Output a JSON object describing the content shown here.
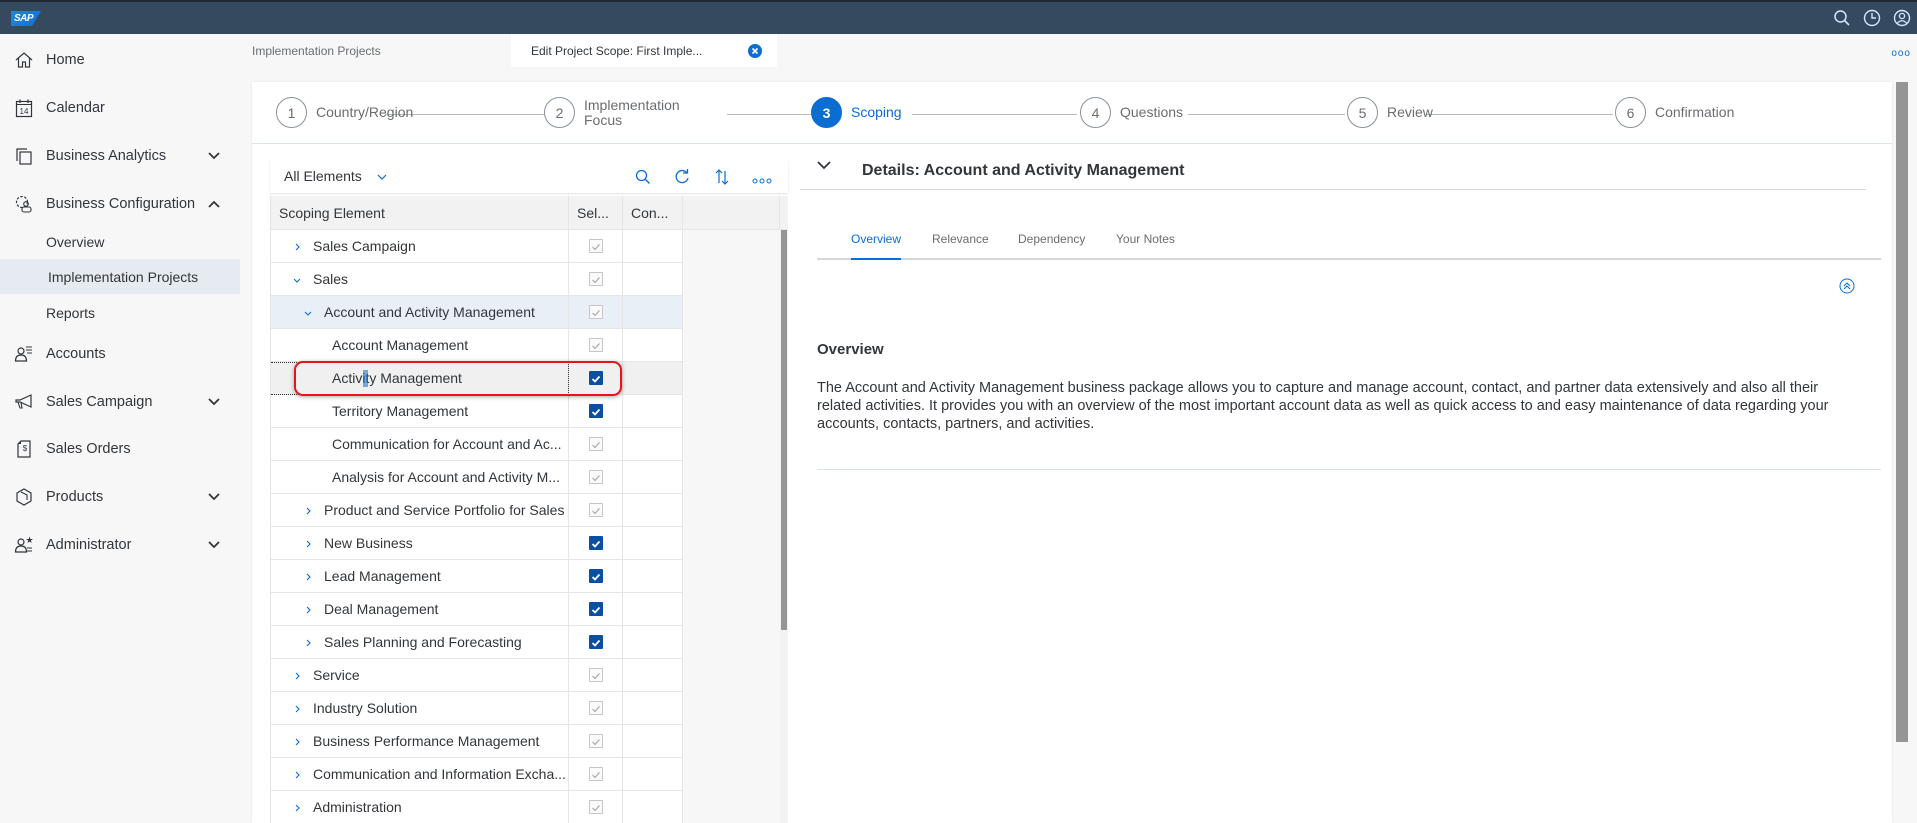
{
  "shell": {
    "logo": "SAP",
    "icons": [
      "search-icon",
      "history-icon",
      "user-icon"
    ]
  },
  "sidebar": {
    "items": [
      {
        "label": "Home",
        "icon": "home-icon"
      },
      {
        "label": "Calendar",
        "icon": "calendar-icon",
        "icon_text": "14"
      },
      {
        "label": "Business Analytics",
        "icon": "analytics-icon",
        "expandable": true,
        "expanded": false
      },
      {
        "label": "Business Configuration",
        "icon": "settings-icon",
        "expandable": true,
        "expanded": true
      },
      {
        "label": "Accounts",
        "icon": "accounts-icon"
      },
      {
        "label": "Sales Campaign",
        "icon": "campaign-icon",
        "expandable": true,
        "expanded": false
      },
      {
        "label": "Sales Orders",
        "icon": "sales-order-icon"
      },
      {
        "label": "Products",
        "icon": "product-icon",
        "expandable": true,
        "expanded": false
      },
      {
        "label": "Administrator",
        "icon": "administrator-icon",
        "expandable": true,
        "expanded": false
      }
    ],
    "sub_items": [
      {
        "label": "Overview",
        "active": false
      },
      {
        "label": "Implementation Projects",
        "active": true
      },
      {
        "label": "Reports",
        "active": false
      }
    ]
  },
  "tabs": [
    {
      "label": "Implementation Projects",
      "active": false
    },
    {
      "label": "Edit Project Scope: First Imple...",
      "active": true,
      "closable": true
    }
  ],
  "wizard": {
    "steps": [
      {
        "number": "1",
        "label": "Country/Region",
        "active": false
      },
      {
        "number": "2",
        "label": "Implementation Focus",
        "active": false
      },
      {
        "number": "3",
        "label": "Scoping",
        "active": true
      },
      {
        "number": "4",
        "label": "Questions",
        "active": false
      },
      {
        "number": "5",
        "label": "Review",
        "active": false
      },
      {
        "number": "6",
        "label": "Confirmation",
        "active": false
      }
    ]
  },
  "tree": {
    "filter": "All Elements",
    "toolbar_icons": [
      "search-icon",
      "refresh-icon",
      "sort-icon",
      "more-icon"
    ],
    "columns": [
      "Scoping Element",
      "Sel...",
      "Con..."
    ],
    "rows": [
      {
        "label": "Sales Campaign",
        "level": 0,
        "expander": "collapsed",
        "selected": true,
        "editable": false
      },
      {
        "label": "Sales",
        "level": 0,
        "expander": "expanded",
        "selected": true,
        "editable": false
      },
      {
        "label": "Account and Activity Management",
        "level": 1,
        "expander": "expanded",
        "selected": true,
        "editable": false,
        "highlighted": true
      },
      {
        "label": "Account Management",
        "level": 2,
        "expander": "none",
        "selected": true,
        "editable": false
      },
      {
        "label": "Activity Management",
        "level": 2,
        "expander": "none",
        "selected": true,
        "editable": true,
        "focused": true
      },
      {
        "label": "Territory Management",
        "level": 2,
        "expander": "none",
        "selected": true,
        "editable": true
      },
      {
        "label": "Communication for Account and Ac...",
        "level": 2,
        "expander": "none",
        "selected": true,
        "editable": false
      },
      {
        "label": "Analysis for Account and Activity M...",
        "level": 2,
        "expander": "none",
        "selected": true,
        "editable": false
      },
      {
        "label": "Product and Service Portfolio for Sales",
        "level": 1,
        "expander": "collapsed",
        "selected": true,
        "editable": false
      },
      {
        "label": "New Business",
        "level": 1,
        "expander": "collapsed",
        "selected": true,
        "editable": true
      },
      {
        "label": "Lead Management",
        "level": 1,
        "expander": "collapsed",
        "selected": true,
        "editable": true
      },
      {
        "label": "Deal Management",
        "level": 1,
        "expander": "collapsed",
        "selected": true,
        "editable": true
      },
      {
        "label": "Sales Planning and Forecasting",
        "level": 1,
        "expander": "collapsed",
        "selected": true,
        "editable": true
      },
      {
        "label": "Service",
        "level": 0,
        "expander": "collapsed",
        "selected": true,
        "editable": false
      },
      {
        "label": "Industry Solution",
        "level": 0,
        "expander": "collapsed",
        "selected": true,
        "editable": false
      },
      {
        "label": "Business Performance Management",
        "level": 0,
        "expander": "collapsed",
        "selected": true,
        "editable": false
      },
      {
        "label": "Communication and Information Excha...",
        "level": 0,
        "expander": "collapsed",
        "selected": true,
        "editable": false
      },
      {
        "label": "Administration",
        "level": 0,
        "expander": "collapsed",
        "selected": true,
        "editable": false
      }
    ]
  },
  "details": {
    "title": "Details: Account and Activity Management",
    "tabs": [
      {
        "label": "Overview",
        "active": true
      },
      {
        "label": "Relevance",
        "active": false
      },
      {
        "label": "Dependency",
        "active": false
      },
      {
        "label": "Your Notes",
        "active": false
      }
    ],
    "section_title": "Overview",
    "section_text": "The Account and Activity Management business package allows you to capture and manage account, contact, and partner data extensively and also all their related activities. It provides you with an overview of the most important account data as well as quick access to and easy maintenance of data regarding your accounts, contacts, partners, and activities."
  },
  "colors": {
    "shell": "#354a5f",
    "accent": "#0a6ed1",
    "checkbox_on": "#0a4fa0",
    "highlight_ring": "#e8141c"
  }
}
